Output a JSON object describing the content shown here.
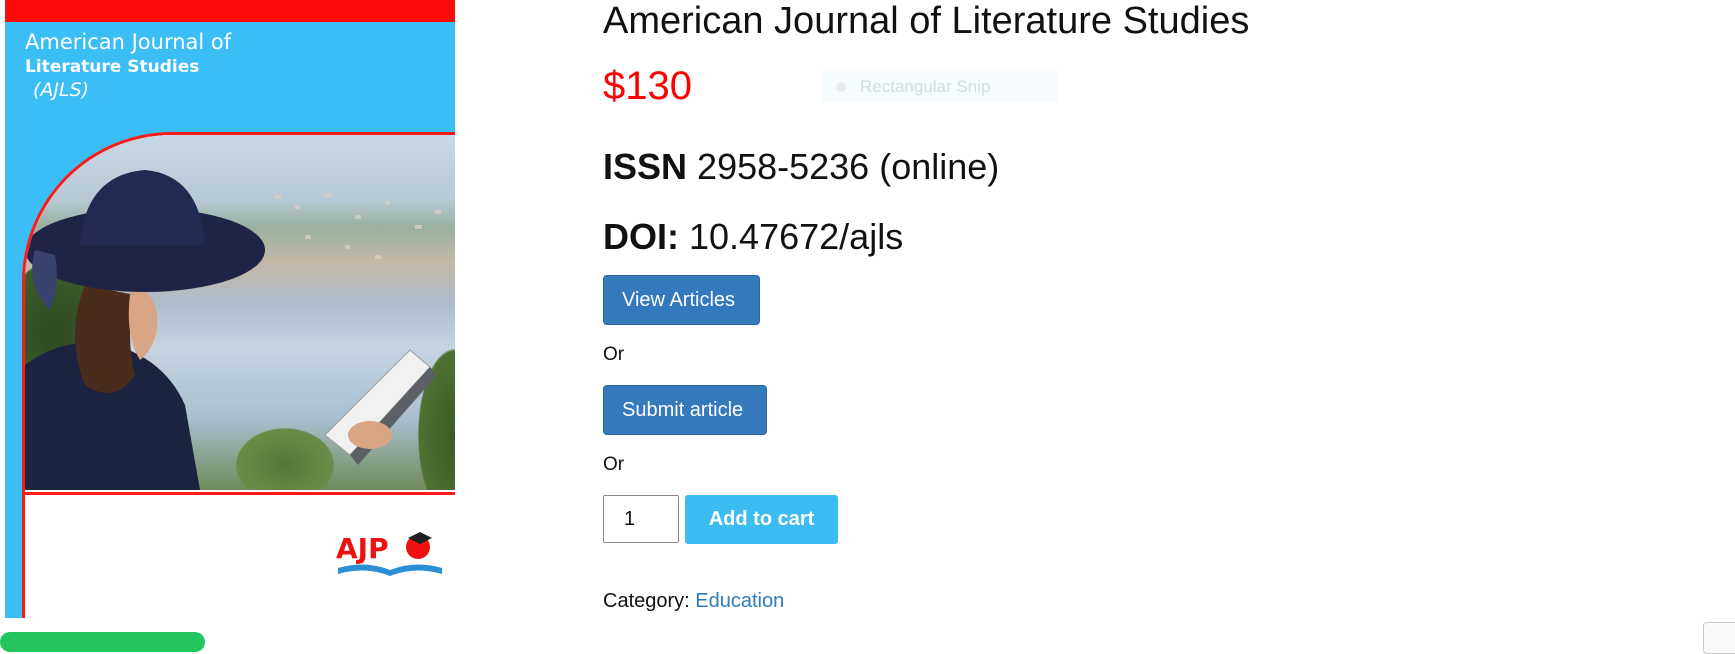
{
  "cover": {
    "title_line1": "American Journal of",
    "title_line2": "Literature Studies",
    "title_line3": "(AJLS)",
    "logo_text": "AJP",
    "colors": {
      "background": "#3bbdf5",
      "accent_red": "#ff0a0a"
    }
  },
  "product": {
    "title": "American Journal of Literature Studies",
    "price": "$130",
    "issn_label": "ISSN",
    "issn_value": "2958-5236 (online)",
    "doi_label": "DOI:",
    "doi_value": "10.47672/ajls"
  },
  "overlay": {
    "snip_label": "Rectangular Snip"
  },
  "actions": {
    "view_articles": "View Articles",
    "or_1": "Or",
    "submit_article": "Submit article",
    "or_2": "Or",
    "quantity": "1",
    "add_to_cart": "Add to cart"
  },
  "meta": {
    "category_label": "Category:",
    "category_value": "Education"
  },
  "colors": {
    "price": "#ff0000",
    "button_primary": "#3379bb",
    "button_cart": "#3cbcf3",
    "link": "#2f7bbd"
  }
}
